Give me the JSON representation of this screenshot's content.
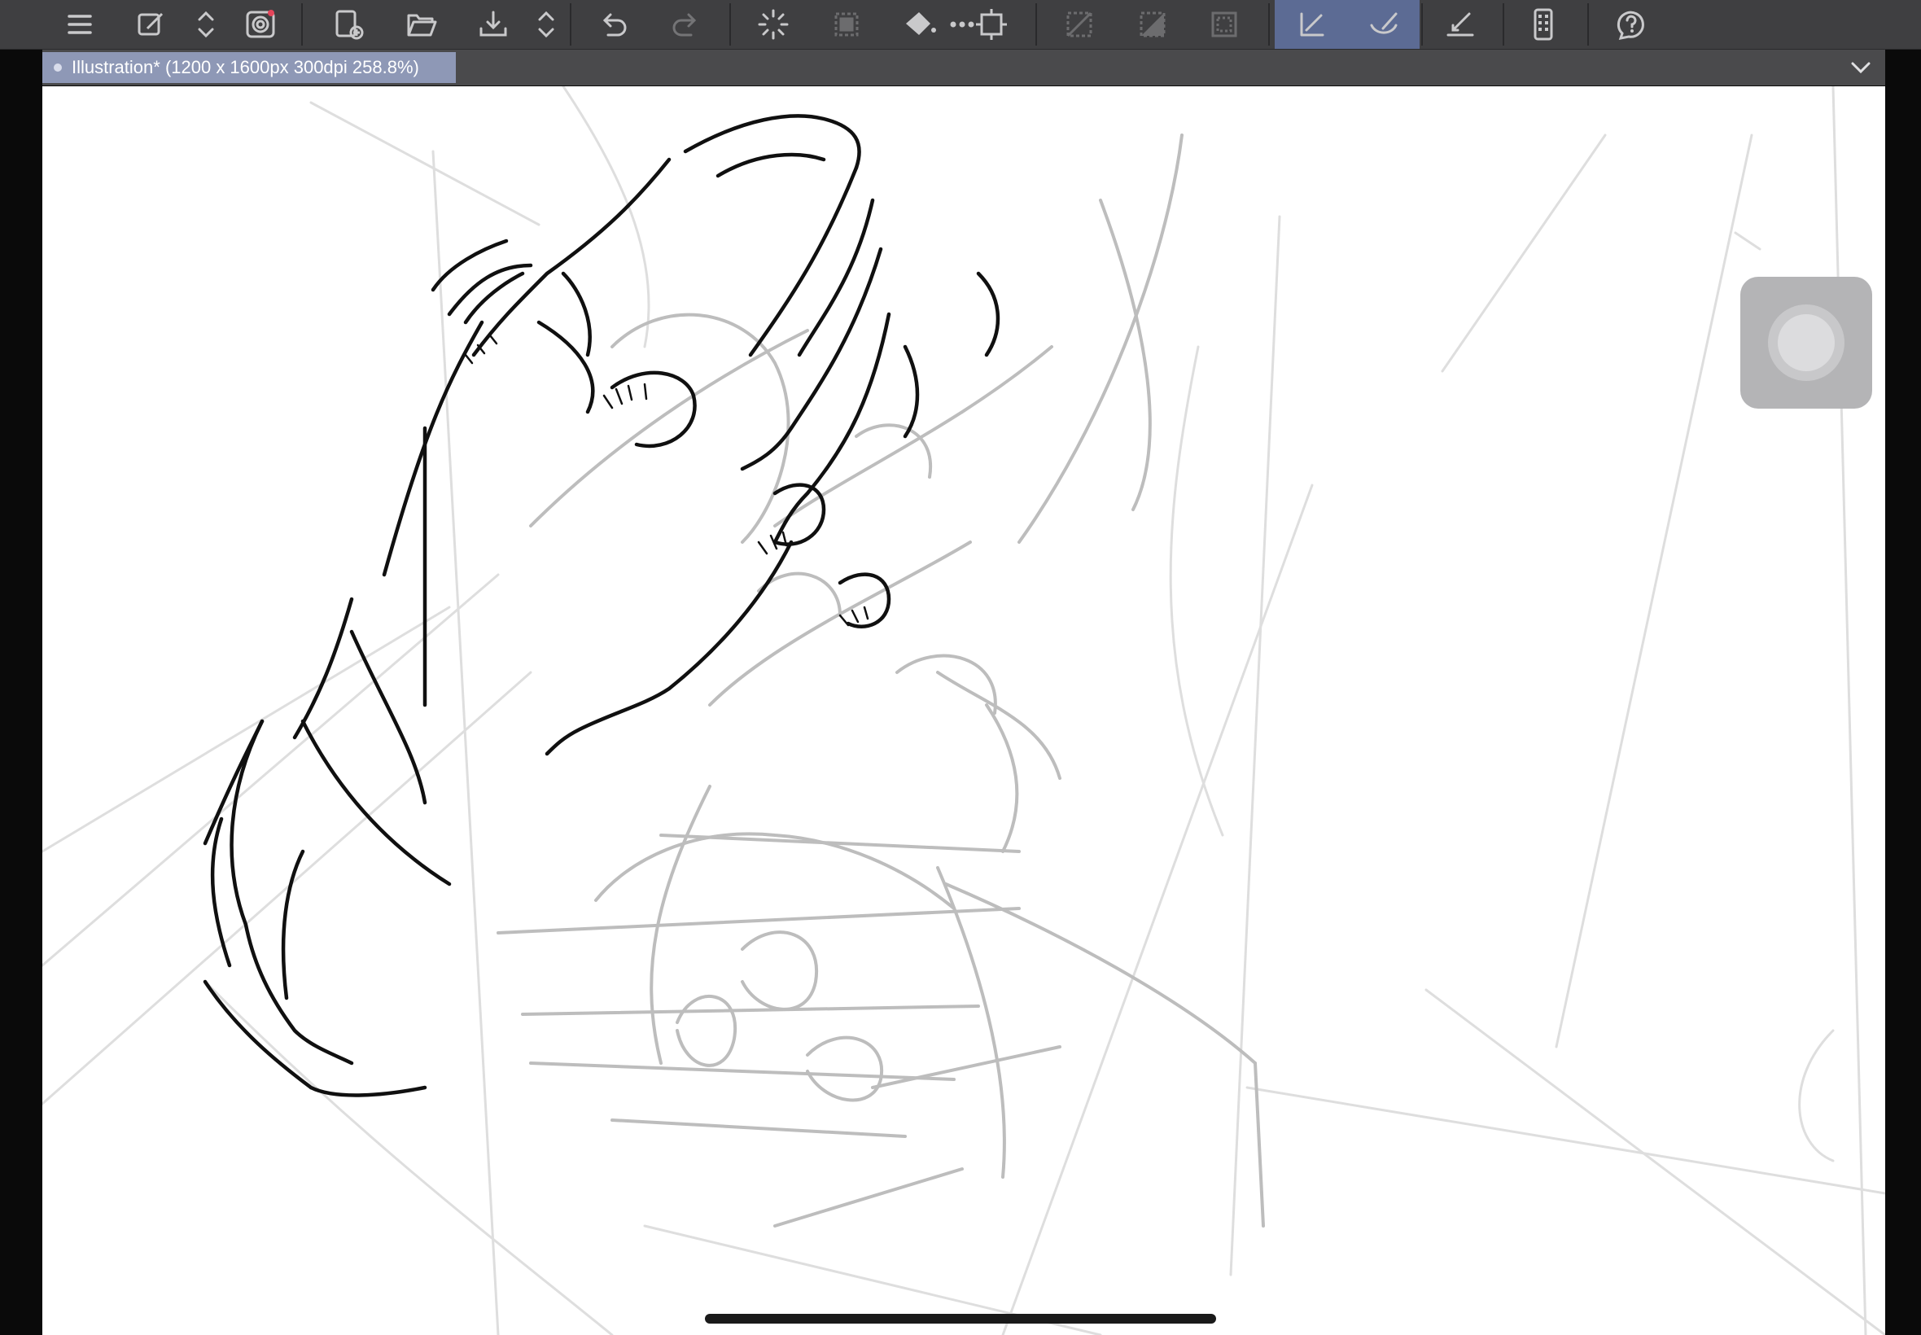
{
  "app": {
    "document_tab": {
      "title": "Illustration* (1200 x 1600px 300dpi 258.8%)"
    }
  },
  "toolbar": {
    "items": [
      {
        "icon": "menu-icon"
      },
      {
        "icon": "pen-settings-icon"
      },
      {
        "icon": "up-down-arrows-icon"
      },
      {
        "icon": "spiral-icon"
      },
      {
        "icon": "new-file-icon"
      },
      {
        "icon": "open-folder-icon"
      },
      {
        "icon": "save-icon"
      },
      {
        "icon": "up-down-arrows-icon"
      },
      {
        "icon": "undo-icon"
      },
      {
        "icon": "redo-icon"
      },
      {
        "icon": "loading-spinner-icon"
      },
      {
        "icon": "transform-icon"
      },
      {
        "icon": "fill-bucket-icon"
      },
      {
        "icon": "selection-frame-icon"
      },
      {
        "icon": "deselect-icon"
      },
      {
        "icon": "invert-selection-icon"
      },
      {
        "icon": "selection-border-icon"
      },
      {
        "icon": "ruler-snap-icon",
        "active": true
      },
      {
        "icon": "brush-snap-icon",
        "active": true
      },
      {
        "icon": "pen-ruler-icon"
      },
      {
        "icon": "device-settings-icon"
      },
      {
        "icon": "help-icon"
      }
    ]
  },
  "colors": {
    "toolbar_bg": "#3f3f41",
    "active_tool": "#5c6b94",
    "tab_bg": "#8e98b6",
    "canvas": "#ffffff"
  },
  "floating_button": {
    "icon": "quick-access-circle-icon"
  }
}
